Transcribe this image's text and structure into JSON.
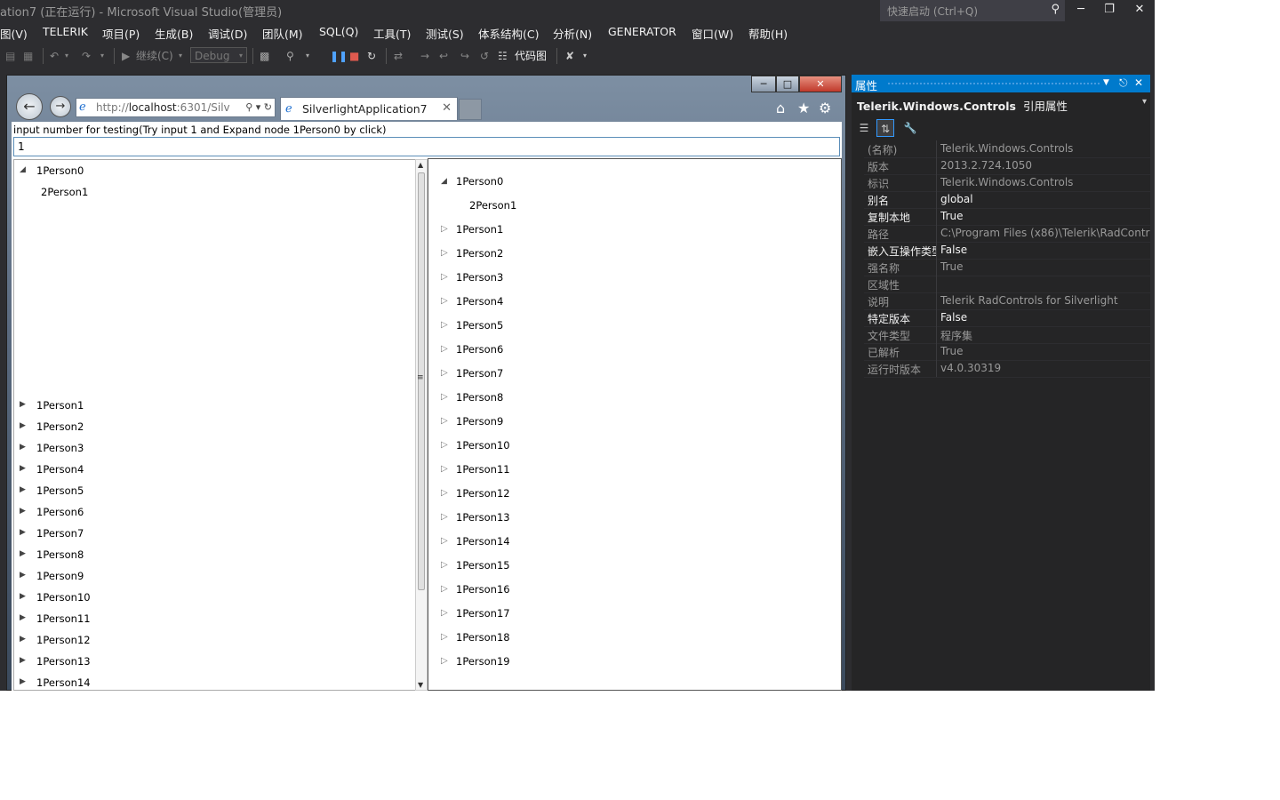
{
  "window": {
    "title": "ation7 (正在运行) - Microsoft Visual Studio(管理员)",
    "quick_launch_placeholder": "快速启动 (Ctrl+Q)"
  },
  "menu": [
    "图(V)",
    "TELERIK",
    "项目(P)",
    "生成(B)",
    "调试(D)",
    "团队(M)",
    "SQL(Q)",
    "工具(T)",
    "测试(S)",
    "体系结构(C)",
    "分析(N)",
    "GENERATOR",
    "窗口(W)",
    "帮助(H)"
  ],
  "toolbar": {
    "continue_label": "继续(C)",
    "config_value": "Debug",
    "codemap_label": "代码图"
  },
  "browser": {
    "url_prefix": "http://",
    "url_host": "localhost",
    "url_rest": ":6301/Silv",
    "tab_title": "SilverlightApplication7"
  },
  "app": {
    "prompt": "input number for testing(Try input 1 and Expand node 1Person0 by click)",
    "input_value": "1",
    "left_tree": {
      "expanded": "1Person0",
      "child": "2Person1",
      "items": [
        "1Person1",
        "1Person2",
        "1Person3",
        "1Person4",
        "1Person5",
        "1Person6",
        "1Person7",
        "1Person8",
        "1Person9",
        "1Person10",
        "1Person11",
        "1Person12",
        "1Person13",
        "1Person14"
      ]
    },
    "right_tree": {
      "expanded": "1Person0",
      "child": "2Person1",
      "items": [
        "1Person1",
        "1Person2",
        "1Person3",
        "1Person4",
        "1Person5",
        "1Person6",
        "1Person7",
        "1Person8",
        "1Person9",
        "1Person10",
        "1Person11",
        "1Person12",
        "1Person13",
        "1Person14",
        "1Person15",
        "1Person16",
        "1Person17",
        "1Person18",
        "1Person19"
      ]
    }
  },
  "properties": {
    "title": "属性",
    "object_name": "Telerik.Windows.Controls",
    "object_type": "引用属性",
    "rows": [
      {
        "name": "(名称)",
        "value": "Telerik.Windows.Controls",
        "editable": false
      },
      {
        "name": "版本",
        "value": "2013.2.724.1050",
        "editable": false
      },
      {
        "name": "标识",
        "value": "Telerik.Windows.Controls",
        "editable": false
      },
      {
        "name": "别名",
        "value": "global",
        "editable": true
      },
      {
        "name": "复制本地",
        "value": "True",
        "editable": true
      },
      {
        "name": "路径",
        "value": "C:\\Program Files (x86)\\Telerik\\RadContro",
        "editable": false
      },
      {
        "name": "嵌入互操作类型",
        "value": "False",
        "editable": true
      },
      {
        "name": "强名称",
        "value": "True",
        "editable": false
      },
      {
        "name": "区域性",
        "value": "",
        "editable": false
      },
      {
        "name": "说明",
        "value": "Telerik RadControls for Silverlight",
        "editable": false
      },
      {
        "name": "特定版本",
        "value": "False",
        "editable": true
      },
      {
        "name": "文件类型",
        "value": "程序集",
        "editable": false
      },
      {
        "name": "已解析",
        "value": "True",
        "editable": false
      },
      {
        "name": "运行时版本",
        "value": "v4.0.30319",
        "editable": false
      }
    ]
  },
  "colors": {
    "accent": "#007acc",
    "chrome": "#2d2d30",
    "panel": "#252526",
    "text_editable": "#f1f1f1",
    "text_readonly": "#999999"
  }
}
